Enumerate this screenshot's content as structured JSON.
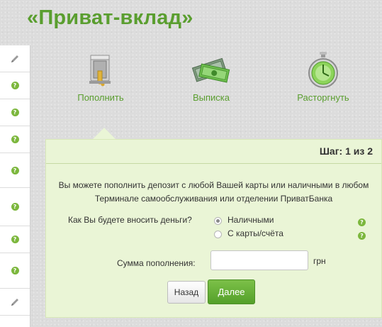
{
  "page": {
    "title": "«Приват-вклад»"
  },
  "actions": [
    {
      "label": "Пополнить",
      "icon": "safe-icon"
    },
    {
      "label": "Выписка",
      "icon": "money-icon"
    },
    {
      "label": "Расторгнуть",
      "icon": "stopwatch-icon"
    }
  ],
  "sidebar": {
    "icons": [
      "pencil-icon",
      "help-icon",
      "help-icon",
      "help-icon",
      "help-icon",
      "help-icon",
      "help-icon",
      "help-icon",
      "pencil-icon"
    ]
  },
  "panel": {
    "step": "Шаг: 1 из 2",
    "info": "Вы можете пополнить депозит с любой Вашей карты или наличными в любом Терминале самообслуживания или отделении ПриватБанка",
    "question": "Как Вы будете вносить деньги?",
    "options": [
      {
        "label": "Наличными",
        "selected": true
      },
      {
        "label": "С карты/счёта",
        "selected": false
      }
    ],
    "sum_label": "Сумма пополнения:",
    "sum_value": "",
    "unit": "грн",
    "back_label": "Назад",
    "next_label": "Далее"
  },
  "colors": {
    "accent": "#5a9e2f",
    "panel_bg": "#eaf5d6",
    "button_green": "#5aa52f"
  }
}
